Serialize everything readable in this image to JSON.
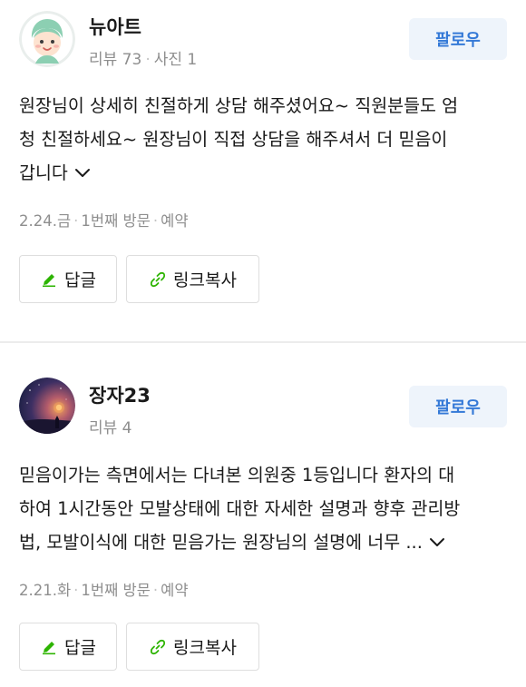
{
  "reviews": [
    {
      "user": {
        "name": "뉴아트",
        "reviews_label": "리뷰 73",
        "photos_label": "사진 1",
        "avatar_icon": "cartoon-face-avatar"
      },
      "follow_label": "팔로우",
      "body_lines": [
        "원장님이 상세히 친절하게 상담 해주셨어요~ 직원분들도 엄",
        "청 친절하세요~ 원장님이 직접 상담을 해주셔서 더 믿음이",
        "갑니다"
      ],
      "visit": {
        "date": "2.24.금",
        "visit_count": "1번째 방문",
        "type": "예약"
      },
      "reply_label": "답글",
      "copy_link_label": "링크복사"
    },
    {
      "user": {
        "name": "장자23",
        "reviews_label": "리뷰 4",
        "avatar_icon": "night-sky-lantern-avatar"
      },
      "follow_label": "팔로우",
      "body_lines": [
        "믿음이가는 측면에서는 다녀본 의원중 1등입니다 환자의 대",
        "하여 1시간동안 모발상태에 대한 자세한 설명과 향후 관리방",
        "법, 모발이식에 대한 믿음가는 원장님의 설명에 너무 ..."
      ],
      "visit": {
        "date": "2.21.화",
        "visit_count": "1번째 방문",
        "type": "예약"
      },
      "reply_label": "답글",
      "copy_link_label": "링크복사"
    }
  ],
  "colors": {
    "accent": "#3479d7",
    "follow_bg": "#eef4fb",
    "reply_icon": "#2db400",
    "link_icon": "#2db400",
    "meta_text": "#8e8e8e"
  },
  "icons": {
    "expand": "chevron-down-icon",
    "reply": "pencil-icon",
    "copy_link": "link-icon"
  }
}
